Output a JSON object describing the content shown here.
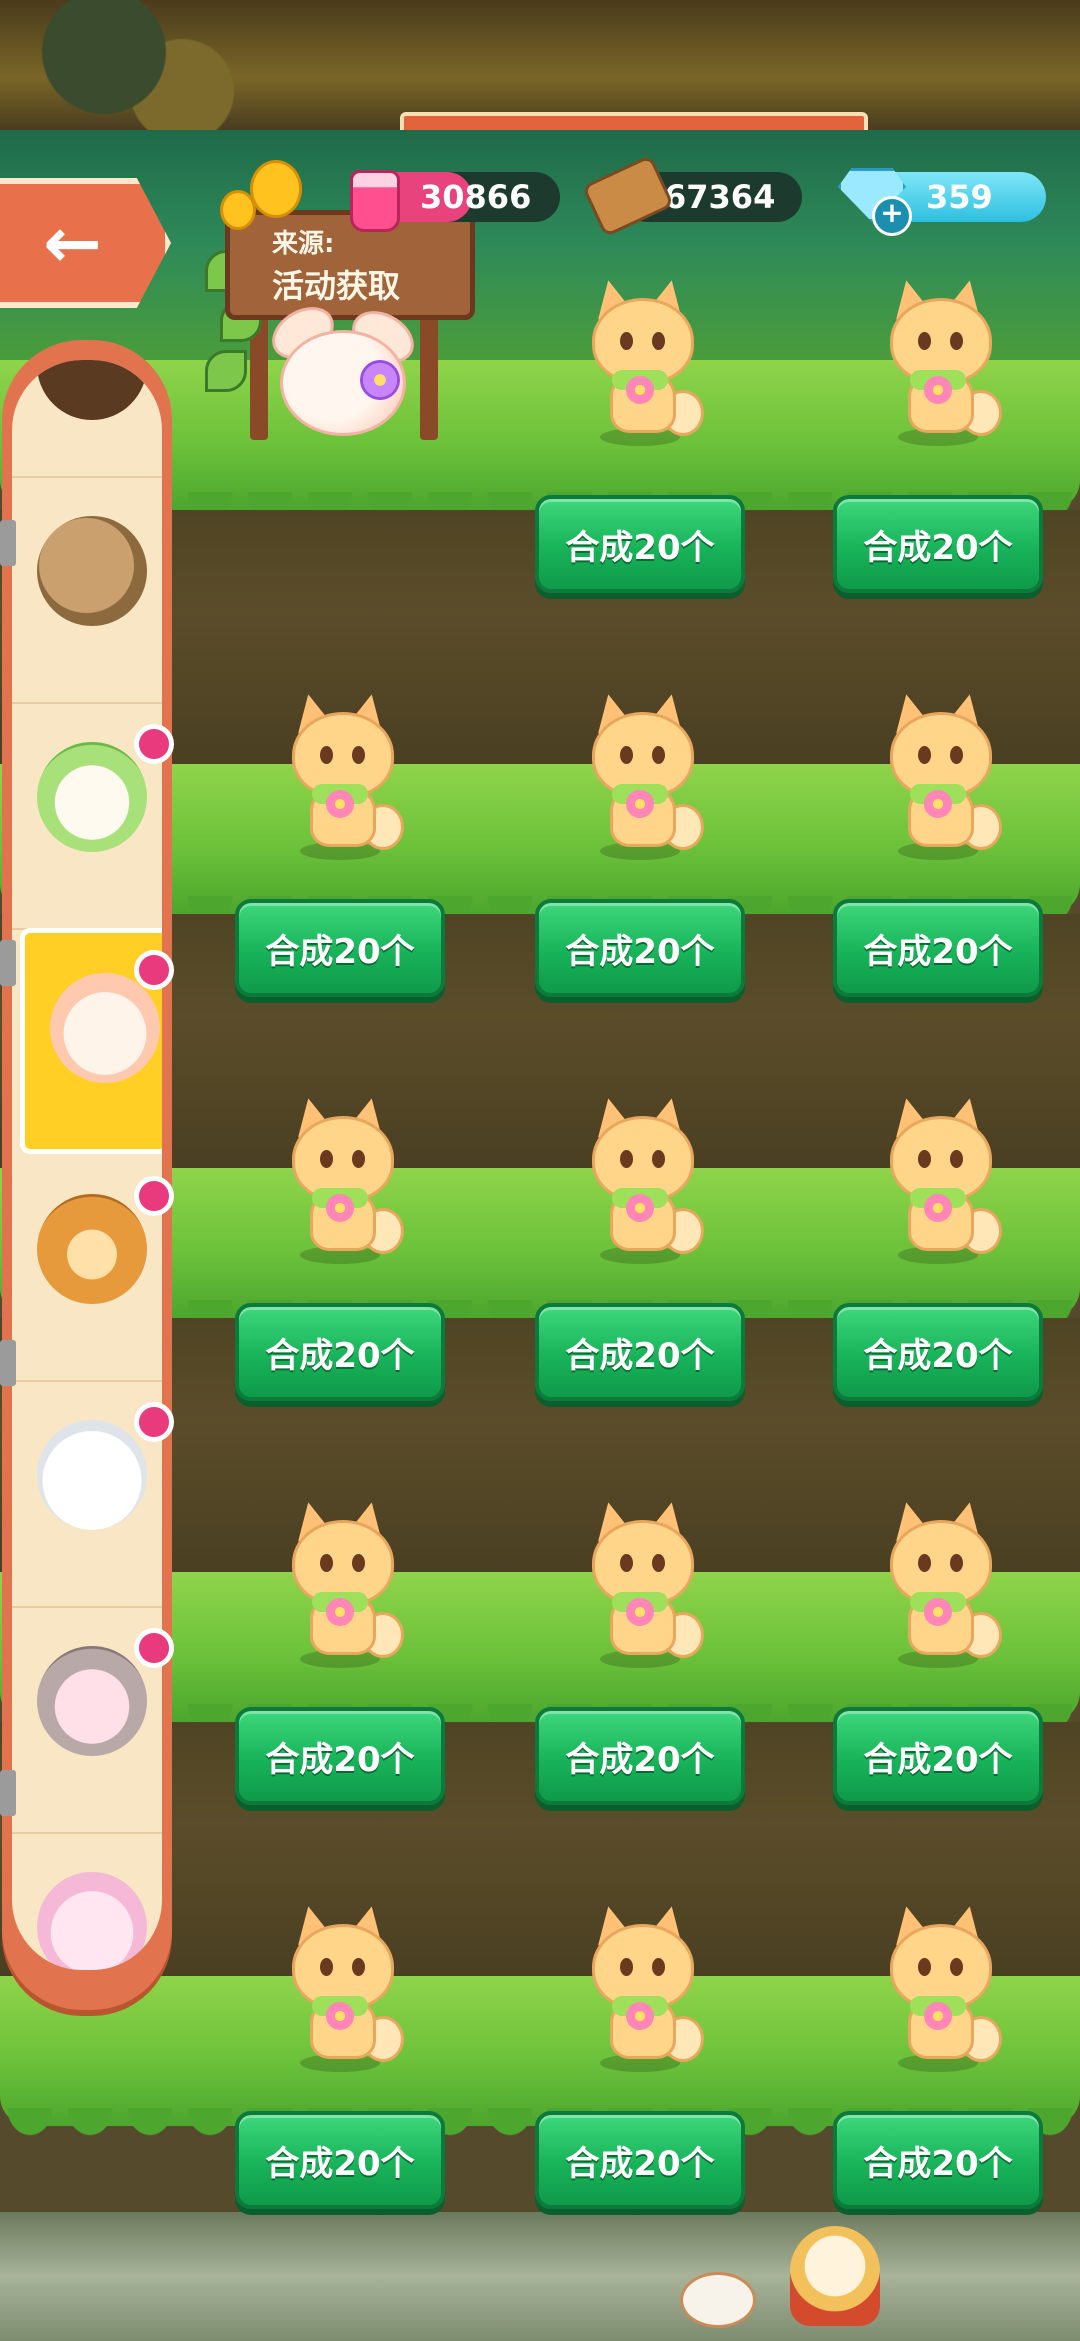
{
  "resources": {
    "potion": {
      "value": "30866",
      "icon": "pink-potion-icon",
      "color": "#e8437c"
    },
    "wood": {
      "value": "67364",
      "icon": "wood-log-icon",
      "color": "#1d3a2e"
    },
    "diamond": {
      "value": "359",
      "icon": "diamond-icon",
      "color": "#39c9e8"
    }
  },
  "sign": {
    "line1": "来源:",
    "line2": "活动获取"
  },
  "back": {
    "icon": "back-arrow-icon"
  },
  "sidebar": {
    "items": [
      {
        "pet": "brown-bowl-pet",
        "badge": false
      },
      {
        "pet": "potato-pet",
        "badge": false
      },
      {
        "pet": "green-leaf-pet",
        "badge": true
      },
      {
        "pet": "winged-fox-pet",
        "badge": true,
        "selected": true
      },
      {
        "pet": "tiger-cub-pet",
        "badge": true
      },
      {
        "pet": "white-bunny-pet",
        "badge": true
      },
      {
        "pet": "gray-cat-pet",
        "badge": true
      },
      {
        "pet": "pink-fox-pet",
        "badge": false
      }
    ]
  },
  "grid": {
    "button_label": "合成20个",
    "rows": [
      [
        "winged-fox-pet",
        "flower-fox-pet",
        "flower-fox-pet"
      ],
      [
        "flower-fox-pet",
        "flower-fox-pet",
        "flower-fox-pet"
      ],
      [
        "flower-fox-pet",
        "flower-fox-pet",
        "flower-fox-pet"
      ],
      [
        "flower-fox-pet",
        "flower-fox-pet",
        "flower-fox-pet"
      ],
      [
        "flower-fox-pet",
        "flower-fox-pet",
        "flower-fox-pet"
      ]
    ],
    "first_cell_has_button": false
  }
}
